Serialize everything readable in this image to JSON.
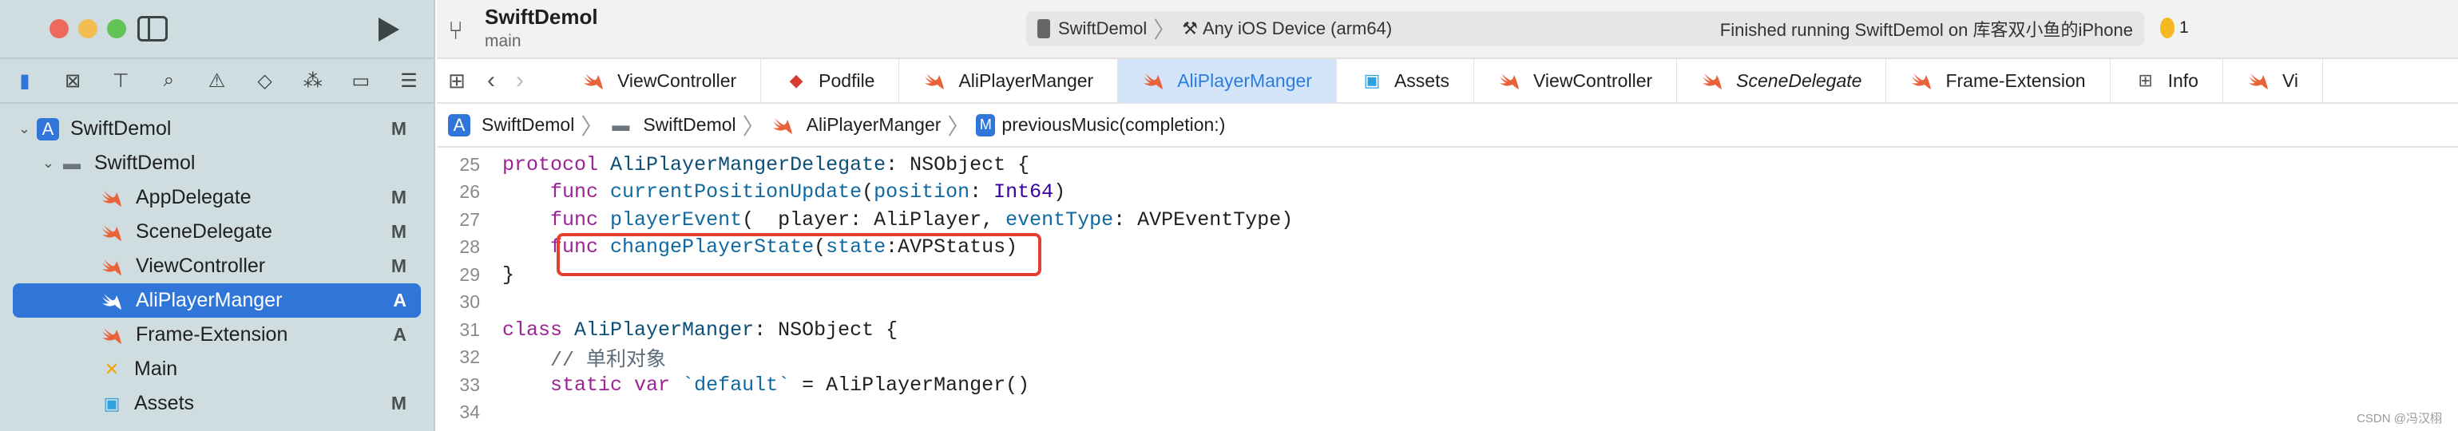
{
  "window": {
    "project": "SwiftDemol",
    "branch": "main",
    "scheme": "SwiftDemol",
    "destination": "Any iOS Device (arm64)",
    "status": "Finished running SwiftDemol on 库客双小鱼的iPhone",
    "warnings": "1"
  },
  "colors": {
    "accent": "#2f76d8",
    "highlight_box": "#e5402f",
    "swift_icon": "#e8623a",
    "warning": "#f5b820"
  },
  "sidebar": {
    "items": [
      {
        "label": "SwiftDemol",
        "badge": "M",
        "icon": "app-icon",
        "indent": 0,
        "chevron": true
      },
      {
        "label": "SwiftDemol",
        "badge": "",
        "icon": "folder-icon",
        "indent": 1,
        "chevron": true
      },
      {
        "label": "AppDelegate",
        "badge": "M",
        "icon": "swift-icon",
        "indent": 2
      },
      {
        "label": "SceneDelegate",
        "badge": "M",
        "icon": "swift-icon",
        "indent": 2
      },
      {
        "label": "ViewController",
        "badge": "M",
        "icon": "swift-icon",
        "indent": 2
      },
      {
        "label": "AliPlayerManger",
        "badge": "A",
        "icon": "swift-icon",
        "indent": 2,
        "selected": true
      },
      {
        "label": "Frame-Extension",
        "badge": "A",
        "icon": "swift-icon",
        "indent": 2
      },
      {
        "label": "Main",
        "badge": "",
        "icon": "storyboard-icon",
        "indent": 2
      },
      {
        "label": "Assets",
        "badge": "M",
        "icon": "assets-icon",
        "indent": 2
      }
    ]
  },
  "tabs": [
    {
      "label": "ViewController",
      "icon": "swift-icon"
    },
    {
      "label": "Podfile",
      "icon": "ruby-icon"
    },
    {
      "label": "AliPlayerManger",
      "icon": "swift-icon"
    },
    {
      "label": "AliPlayerManger",
      "icon": "swift-icon",
      "active": true
    },
    {
      "label": "Assets",
      "icon": "assets-icon"
    },
    {
      "label": "ViewController",
      "icon": "swift-icon"
    },
    {
      "label": "SceneDelegate",
      "icon": "swift-icon",
      "italic": true
    },
    {
      "label": "Frame-Extension",
      "icon": "swift-icon"
    },
    {
      "label": "Info",
      "icon": "table-icon"
    },
    {
      "label": "Vi",
      "icon": "swift-icon"
    }
  ],
  "breadcrumb": [
    "SwiftDemol",
    "SwiftDemol",
    "AliPlayerManger",
    "previousMusic(completion:)"
  ],
  "code": [
    {
      "n": "25",
      "tokens": [
        [
          "kw",
          "protocol"
        ],
        [
          "pl",
          " "
        ],
        [
          "cls",
          "AliPlayerMangerDelegate"
        ],
        [
          "pl",
          ": NSObject {"
        ]
      ]
    },
    {
      "n": "26",
      "tokens": [
        [
          "pl",
          "    "
        ],
        [
          "kw",
          "func"
        ],
        [
          "pl",
          " "
        ],
        [
          "id",
          "currentPositionUpdate"
        ],
        [
          "pl",
          "("
        ],
        [
          "id",
          "position"
        ],
        [
          "pl",
          ": "
        ],
        [
          "ty",
          "Int64"
        ],
        [
          "pl",
          ")"
        ]
      ]
    },
    {
      "n": "27",
      "tokens": [
        [
          "pl",
          "    "
        ],
        [
          "kw",
          "func"
        ],
        [
          "pl",
          " "
        ],
        [
          "id",
          "playerEvent"
        ],
        [
          "pl",
          "(  player: AliPlayer, "
        ],
        [
          "id",
          "eventType"
        ],
        [
          "pl",
          ": AVPEventType)"
        ]
      ]
    },
    {
      "n": "28",
      "tokens": [
        [
          "pl",
          "    "
        ],
        [
          "kw",
          "func"
        ],
        [
          "pl",
          " "
        ],
        [
          "id",
          "changePlayerState"
        ],
        [
          "pl",
          "("
        ],
        [
          "id",
          "state"
        ],
        [
          "pl",
          ":AVPStatus)"
        ]
      ]
    },
    {
      "n": "29",
      "tokens": [
        [
          "pl",
          "}"
        ]
      ]
    },
    {
      "n": "30",
      "tokens": []
    },
    {
      "n": "31",
      "tokens": [
        [
          "kw",
          "class"
        ],
        [
          "pl",
          " "
        ],
        [
          "cls",
          "AliPlayerManger"
        ],
        [
          "pl",
          ": NSObject {"
        ]
      ]
    },
    {
      "n": "32",
      "tokens": [
        [
          "pl",
          "    "
        ],
        [
          "cm",
          "// 单利对象"
        ]
      ]
    },
    {
      "n": "33",
      "tokens": [
        [
          "pl",
          "    "
        ],
        [
          "kw",
          "static"
        ],
        [
          "pl",
          " "
        ],
        [
          "kw",
          "var"
        ],
        [
          "pl",
          " "
        ],
        [
          "id",
          "`default`"
        ],
        [
          "pl",
          " = AliPlayerManger()"
        ]
      ]
    },
    {
      "n": "34",
      "tokens": []
    }
  ],
  "watermark": "CSDN @冯汉栩"
}
